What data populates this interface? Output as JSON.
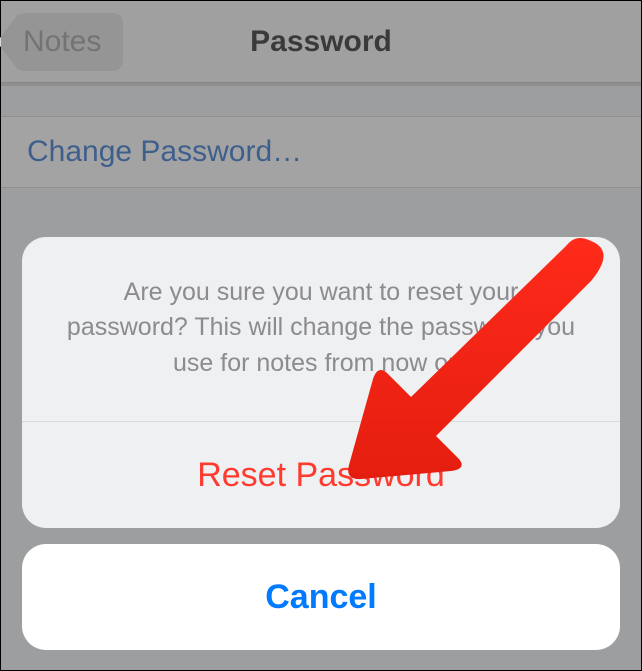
{
  "navbar": {
    "back_label": "Notes",
    "title": "Password"
  },
  "list": {
    "change_password_label": "Change Password…"
  },
  "sheet": {
    "message": "Are you sure you want to reset your password? This will change the password you use for notes from now on.",
    "reset_label": "Reset Password",
    "cancel_label": "Cancel"
  }
}
